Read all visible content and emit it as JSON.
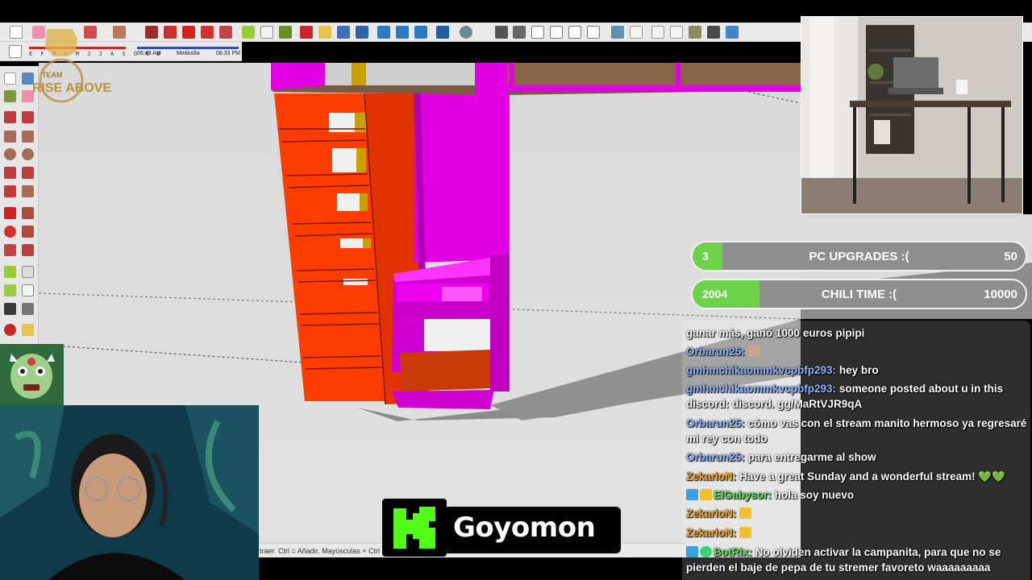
{
  "shadow_settings": {
    "months": "E F M A M J J A S O N D",
    "time_start": "06:49 AM",
    "time_mid": "Mediodía",
    "time_end": "06:33 PM"
  },
  "team_logo": {
    "line1": "TEAM",
    "line2": "RISE ABOVE"
  },
  "status_bar": {
    "hint": "traer. Ctrl = Añadir. Mayúsculas + Ctrl ="
  },
  "goals": [
    {
      "current": "3",
      "title": "PC UPGRADES :(",
      "target": "50",
      "progress": 0.06
    },
    {
      "current": "2004",
      "title": "CHILI TIME :(",
      "target": "10000",
      "progress": 0.2
    }
  ],
  "chat": {
    "messages": [
      {
        "user": "",
        "text": "ganar más, ganó 1000 euros pipipi",
        "user_color": "#ffffff"
      },
      {
        "user": "Orbarun25:",
        "text": "",
        "user_color": "#8fb4ff"
      },
      {
        "user": "gmhmchikaommkvcpbfp293:",
        "text": "hey bro",
        "user_color": "#8fb4ff"
      },
      {
        "user": "gmhmchikaommkvcpbfp293:",
        "text": "someone posted about u in this discord: discord. gg/MaRtVJR9qA",
        "user_color": "#8fb4ff"
      },
      {
        "user": "Orbarun25:",
        "text": "cómo vas con el stream manito hermoso ya regresaré mi rey con todo",
        "user_color": "#8fb4ff"
      },
      {
        "user": "Orbarun25:",
        "text": "para entregarme al show",
        "user_color": "#8fb4ff"
      },
      {
        "user": "ZekarioN:",
        "text": "Have a great Sunday and a wonderful stream! 💚💚",
        "user_color": "#f5a623"
      },
      {
        "user": "ElGabysor:",
        "text": "hola soy nuevo",
        "user_color": "#5ee05e"
      },
      {
        "user": "ZekarioN:",
        "text": "",
        "user_color": "#f5a623"
      },
      {
        "user": "ZekarioN:",
        "text": "",
        "user_color": "#f5a623"
      },
      {
        "user": "BotRix:",
        "text": "No olviden activar la campanita, para que no se pierden el baje de pepa de tu stremer favoreto waaaaaaaaa",
        "user_color": "#5ee05e"
      }
    ]
  },
  "kick": {
    "logo_letter": "K",
    "name": "Goyomon"
  },
  "colors": {
    "shelf_orange": "#ff3d00",
    "panel_magenta": "#e100e1",
    "goal_green": "#6bd24a",
    "kick_green": "#53fc18"
  }
}
